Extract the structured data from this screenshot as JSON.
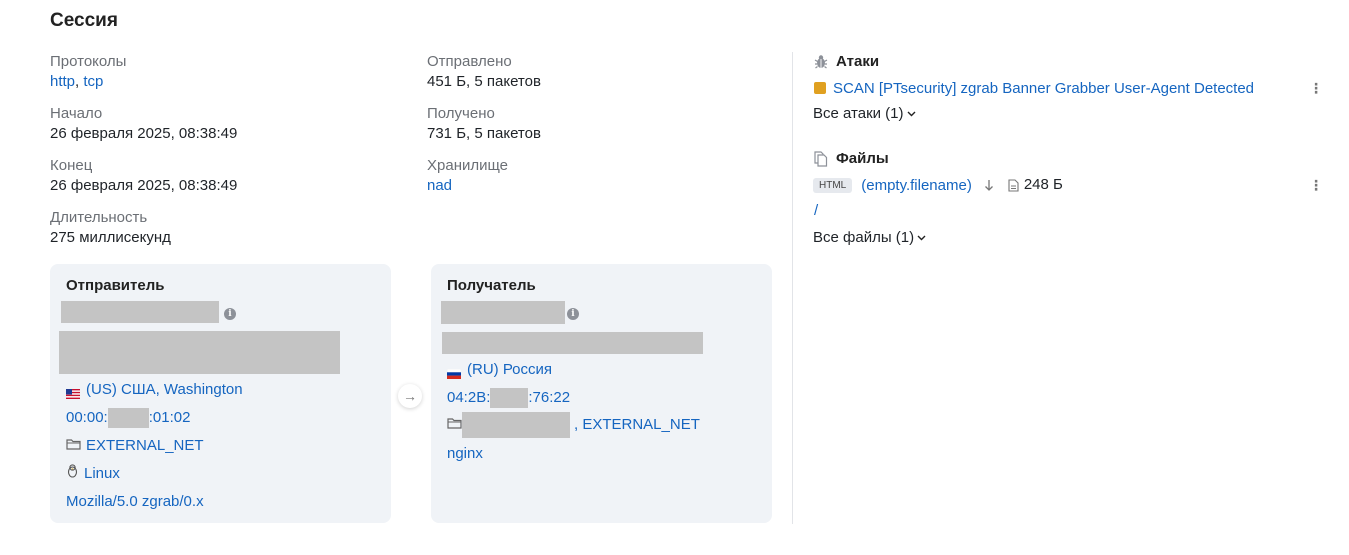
{
  "session": {
    "title": "Сессия",
    "protocols_label": "Протоколы",
    "protocols": [
      "http",
      "tcp"
    ],
    "protocols_separator": ",",
    "start_label": "Начало",
    "start_value": "26 февраля 2025, 08:38:49",
    "end_label": "Конец",
    "end_value": "26 февраля 2025, 08:38:49",
    "duration_label": "Длительность",
    "duration_value": "275 миллисекунд",
    "sent_label": "Отправлено",
    "sent_value": "451 Б, 5 пакетов",
    "received_label": "Получено",
    "received_value": "731 Б, 5 пакетов",
    "storage_label": "Хранилище",
    "storage_value": "nad"
  },
  "sender": {
    "title": "Отправитель",
    "geo": "(US) США, Washington",
    "mac_prefix": "00:00:",
    "mac_suffix": ":01:02",
    "network": "EXTERNAL_NET",
    "os": "Linux",
    "user_agent": "Mozilla/5.0 zgrab/0.x"
  },
  "receiver": {
    "title": "Получатель",
    "geo": "(RU) Россия",
    "mac_prefix": "04:2B:",
    "mac_suffix": ":76:22",
    "network": ", EXTERNAL_NET",
    "app": "nginx"
  },
  "attacks": {
    "title": "Атаки",
    "items": [
      {
        "name": "SCAN [PTsecurity] zgrab Banner Grabber User-Agent Detected",
        "severity_color": "#e0a020"
      }
    ],
    "all_label": "Все атаки (1)"
  },
  "files": {
    "title": "Файлы",
    "items": [
      {
        "type": "HTML",
        "name": "(empty.filename)",
        "size": "248 Б",
        "path": "/"
      }
    ],
    "all_label": "Все файлы (1)"
  },
  "icons": {
    "attacks": "bug-icon",
    "files": "files-icon",
    "info": "info-icon",
    "folder": "folder-icon",
    "linux": "penguin-icon",
    "download": "download-icon",
    "file": "file-icon",
    "more": "kebab-icon",
    "arrow": "arrow-right-icon",
    "chevron": "chevron-down-icon"
  }
}
